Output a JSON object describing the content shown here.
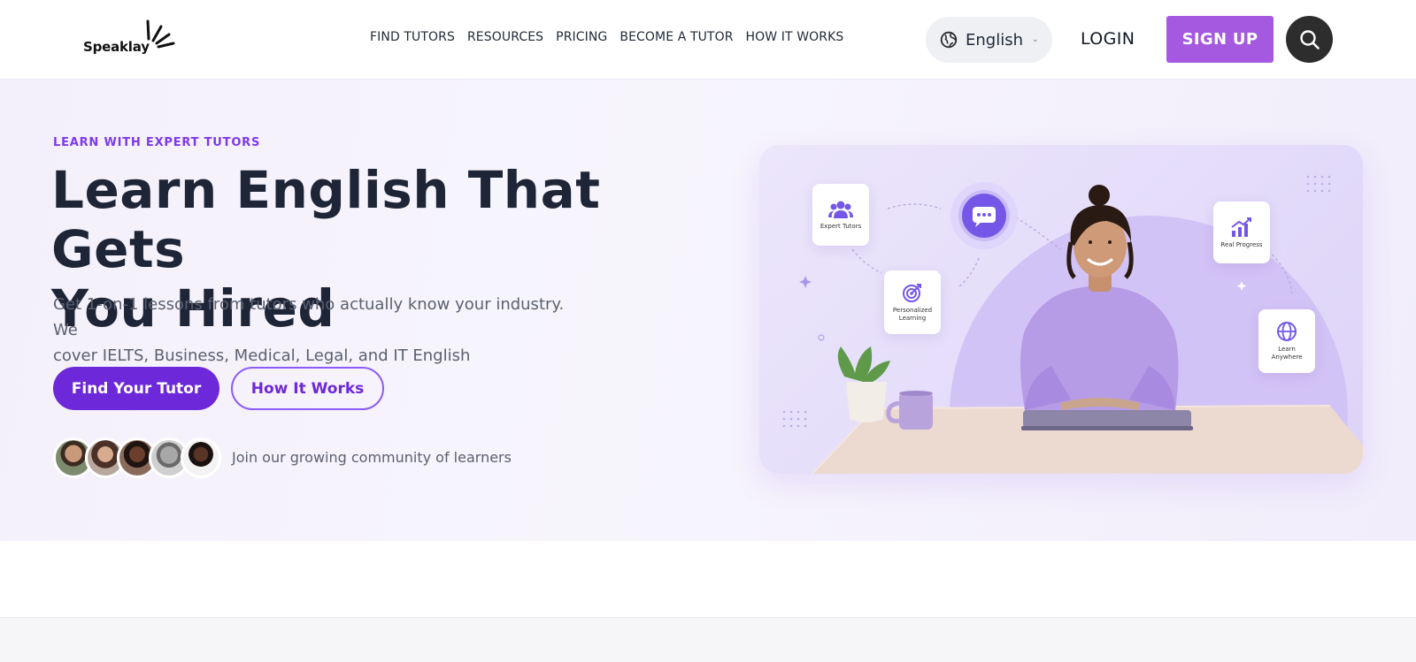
{
  "brand": {
    "name": "Speaklay",
    "accent": "#7c3aed",
    "signup_color": "#a459e0"
  },
  "nav": {
    "items": [
      {
        "label": "FIND TUTORS"
      },
      {
        "label": "RESOURCES"
      },
      {
        "label": "PRICING"
      },
      {
        "label": "BECOME A TUTOR"
      },
      {
        "label": "HOW IT WORKS"
      }
    ]
  },
  "language": {
    "label": "English",
    "icon": "globe-icon"
  },
  "auth": {
    "login_label": "LOGIN",
    "signup_label": "SIGN UP"
  },
  "search": {
    "icon": "search-icon"
  },
  "hero": {
    "eyebrow": "LEARN WITH EXPERT TUTORS",
    "headline_line1": "Learn English That Gets",
    "headline_line2": "You Hired",
    "subtext_line1": "Get 1-on-1 lessons from tutors who actually know your industry. We",
    "subtext_line2": "cover IELTS, Business, Medical, Legal, and IT English",
    "primary_cta": "Find Your Tutor",
    "secondary_cta": "How It Works",
    "community_text": "Join our growing community of learners"
  },
  "illustration": {
    "cards": {
      "expert_tutors": "Expert Tutors",
      "personalized_line1": "Personalized",
      "personalized_line2": "Learning",
      "real_progress": "Real Progress",
      "learn_anywhere_line1": "Learn",
      "learn_anywhere_line2": "Anywhere"
    }
  }
}
